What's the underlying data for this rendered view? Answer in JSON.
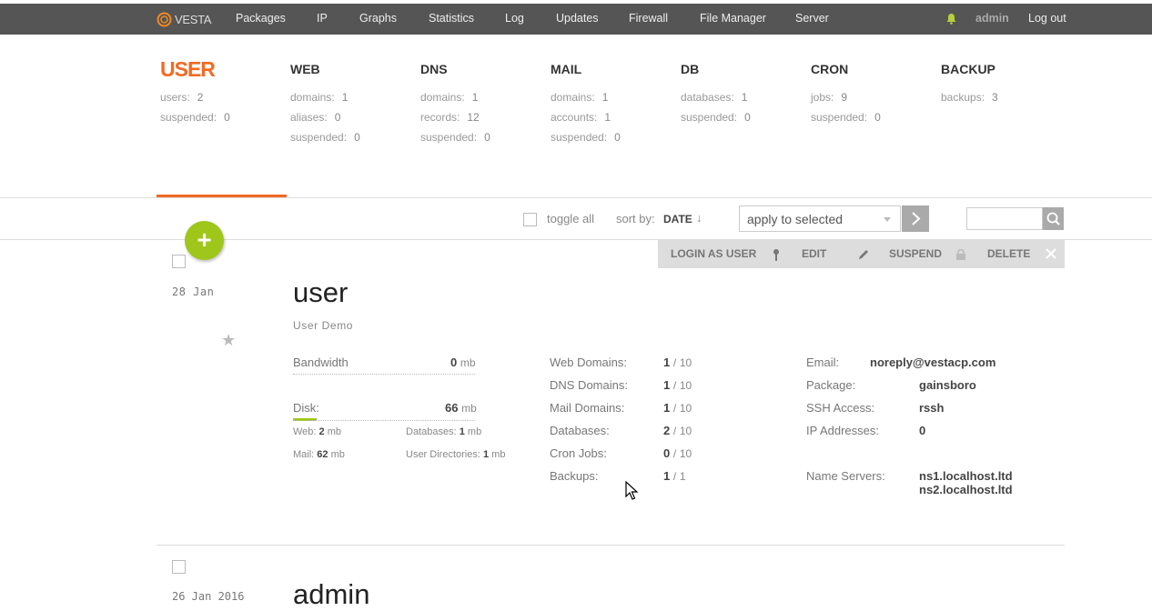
{
  "nav": {
    "logo": "VESTA",
    "items": [
      "Packages",
      "IP",
      "Graphs",
      "Statistics",
      "Log",
      "Updates",
      "Firewall",
      "File Manager",
      "Server"
    ],
    "user": "admin",
    "logout": "Log out",
    "icons": {
      "logo": "vesta-logo-icon",
      "notifications": "bell-icon"
    }
  },
  "stats": [
    {
      "title": "USER",
      "rows": [
        {
          "label": "users:",
          "value": "2"
        },
        {
          "label": "suspended:",
          "value": "0"
        }
      ]
    },
    {
      "title": "WEB",
      "rows": [
        {
          "label": "domains:",
          "value": "1"
        },
        {
          "label": "aliases:",
          "value": "0"
        },
        {
          "label": "suspended:",
          "value": "0"
        }
      ]
    },
    {
      "title": "DNS",
      "rows": [
        {
          "label": "domains:",
          "value": "1"
        },
        {
          "label": "records:",
          "value": "12"
        },
        {
          "label": "suspended:",
          "value": "0"
        }
      ]
    },
    {
      "title": "MAIL",
      "rows": [
        {
          "label": "domains:",
          "value": "1"
        },
        {
          "label": "accounts:",
          "value": "1"
        },
        {
          "label": "suspended:",
          "value": "0"
        }
      ]
    },
    {
      "title": "DB",
      "rows": [
        {
          "label": "databases:",
          "value": "1"
        },
        {
          "label": "suspended:",
          "value": "0"
        }
      ]
    },
    {
      "title": "CRON",
      "rows": [
        {
          "label": "jobs:",
          "value": "9"
        },
        {
          "label": "suspended:",
          "value": "0"
        }
      ]
    },
    {
      "title": "BACKUP",
      "rows": [
        {
          "label": "backups:",
          "value": "3"
        }
      ]
    }
  ],
  "toolbar": {
    "toggle_all": "toggle all",
    "sort_by": "sort by:",
    "sort_value": "DATE",
    "sort_arrow": "↓",
    "apply_selected": "apply to selected",
    "search_placeholder": ""
  },
  "add_button": "+",
  "actions": {
    "login_as_user": "LOGIN AS USER",
    "edit": "EDIT",
    "suspend": "SUSPEND",
    "delete": "DELETE"
  },
  "user_row": {
    "date": "28  Jan",
    "name": "user",
    "description": "User Demo",
    "bandwidth_label": "Bandwidth",
    "bandwidth_value": "0",
    "bandwidth_unit": "mb",
    "disk_label": "Disk:",
    "disk_value": "66",
    "disk_unit": "mb",
    "disk_usage_fraction": 0.13,
    "web_label": "Web:",
    "web_value": "2",
    "mail_label": "Mail:",
    "mail_value": "62",
    "db_label": "Databases:",
    "db_value": "1",
    "udir_label": "User Directories:",
    "udir_value": "1",
    "unit": "mb",
    "limits": [
      {
        "label": "Web Domains:",
        "used": "1",
        "max": "10"
      },
      {
        "label": "DNS Domains:",
        "used": "1",
        "max": "10"
      },
      {
        "label": "Mail Domains:",
        "used": "1",
        "max": "10"
      },
      {
        "label": "Databases:",
        "used": "2",
        "max": "10"
      },
      {
        "label": "Cron Jobs:",
        "used": "0",
        "max": "10"
      },
      {
        "label": "Backups:",
        "used": "1",
        "max": "1"
      }
    ],
    "email_label": "Email:",
    "email_value": "noreply@vestacp.com",
    "package_label": "Package:",
    "package_value": "gainsboro",
    "ssh_label": "SSH Access:",
    "ssh_value": "rssh",
    "ip_label": "IP Addresses:",
    "ip_value": "0",
    "ns_label": "Name Servers:",
    "ns1": "ns1.localhost.ltd",
    "ns2": "ns2.localhost.ltd"
  },
  "next_row": {
    "date": "26  Jan  2016",
    "name": "admin"
  }
}
